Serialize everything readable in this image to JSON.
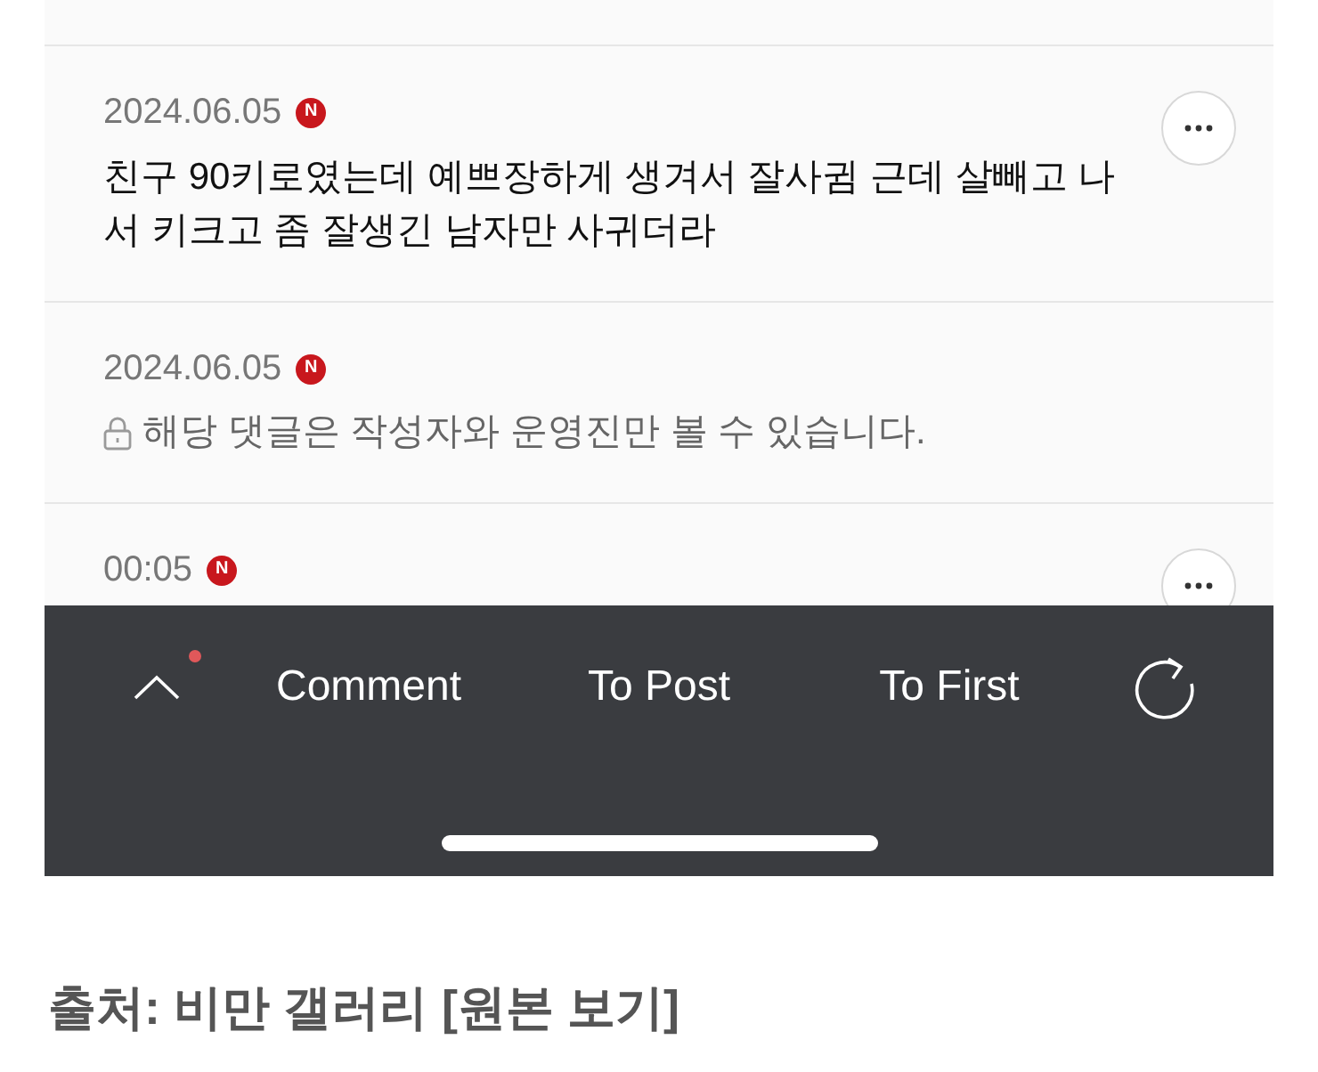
{
  "comments": [
    {
      "date": "2024.06.05",
      "badge": "N",
      "kind": "text",
      "text": "친구 90키로였는데 예쁘장하게 생겨서 잘사귐 근데 살빼고 나서 키크고 좀 잘생긴 남자만 사귀더라",
      "menu_button": true
    },
    {
      "date": "2024.06.05",
      "badge": "N",
      "kind": "private",
      "text": "해당 댓글은 작성자와 운영진만 볼 수 있습니다.",
      "menu_button": false
    },
    {
      "date": "00:05",
      "badge": "N",
      "menu_button": true
    }
  ],
  "bottom_bar": {
    "items": [
      {
        "kind": "up",
        "alert": true
      },
      {
        "kind": "label",
        "label": "Comment"
      },
      {
        "kind": "label",
        "label": "To Post"
      },
      {
        "kind": "label",
        "label": "To First"
      },
      {
        "kind": "refresh"
      }
    ]
  },
  "source": {
    "text": "출처: 비만 갤러리",
    "link": "[원본 보기]"
  }
}
